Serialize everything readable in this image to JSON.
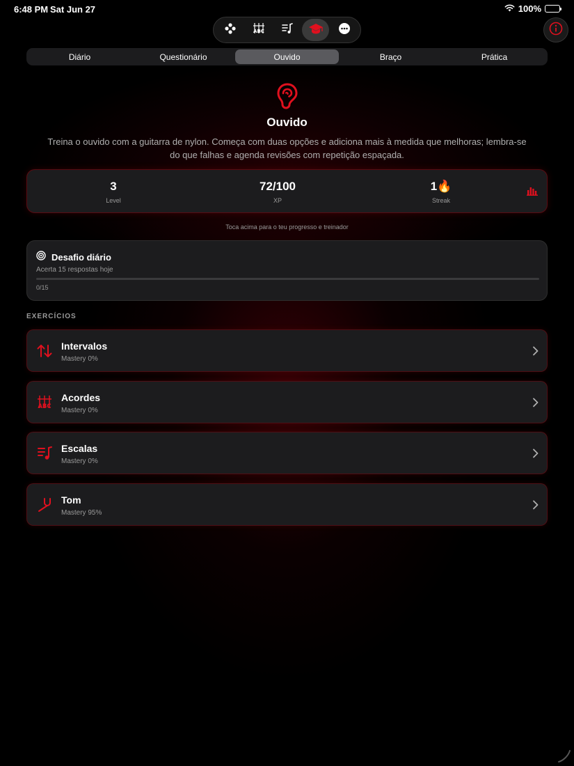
{
  "status_bar": {
    "time": "6:48 PM",
    "date": "Sat Jun 27",
    "battery": "100%"
  },
  "toolbar": {
    "items": [
      {
        "name": "games",
        "icon": "gamepad-icon"
      },
      {
        "name": "chords",
        "icon": "chord-diagram-icon"
      },
      {
        "name": "scales",
        "icon": "music-list-icon"
      },
      {
        "name": "learn",
        "icon": "graduation-cap-icon",
        "active": true
      },
      {
        "name": "more",
        "icon": "ellipsis-icon"
      }
    ]
  },
  "tabs": [
    {
      "label": "Diário"
    },
    {
      "label": "Questionário"
    },
    {
      "label": "Ouvido",
      "active": true
    },
    {
      "label": "Braço"
    },
    {
      "label": "Prática"
    }
  ],
  "hero": {
    "icon": "ear-icon",
    "title": "Ouvido",
    "description": "Treina o ouvido com a guitarra de nylon. Começa com duas opções e adiciona mais à medida que melhoras; lembra-se do que falhas e agenda revisões com repetição espaçada."
  },
  "stats": {
    "level_value": "3",
    "level_label": "Level",
    "xp_value": "72/100",
    "xp_label": "XP",
    "streak_value": "1🔥",
    "streak_label": "Streak",
    "hint": "Toca acima para o teu progresso e treinador"
  },
  "challenge": {
    "title": "Desafio diário",
    "subtitle": "Acerta 15 respostas hoje",
    "progress": 0,
    "count": "0/15"
  },
  "section": {
    "title": "EXERCÍCIOS"
  },
  "exercises": [
    {
      "name": "Intervalos",
      "mastery": "Mastery 0%",
      "icon": "up-down-arrows-icon"
    },
    {
      "name": "Acordes",
      "mastery": "Mastery 0%",
      "icon": "chord-diagram-icon"
    },
    {
      "name": "Escalas",
      "mastery": "Mastery 0%",
      "icon": "music-list-icon"
    },
    {
      "name": "Tom",
      "mastery": "Mastery 95%",
      "icon": "tuning-fork-icon"
    }
  ],
  "colors": {
    "accent": "#e0101e",
    "background": "#000000",
    "card": "#1c1c1e",
    "muted_text": "#9a9a9a"
  }
}
